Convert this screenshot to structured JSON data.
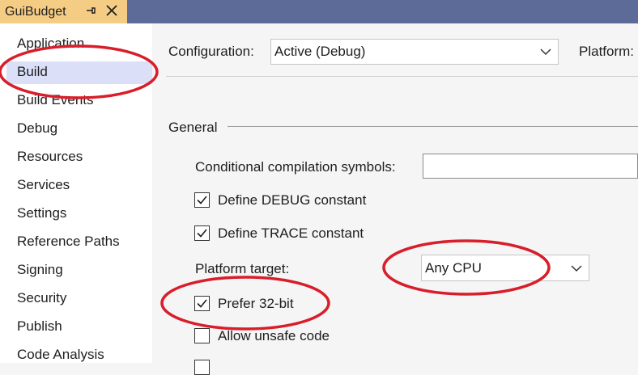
{
  "document_tab": {
    "title": "GuiBudget",
    "pin_icon": "pin-icon",
    "close_icon": "close-icon"
  },
  "sidebar": {
    "items": [
      {
        "label": "Application"
      },
      {
        "label": "Build",
        "selected": true
      },
      {
        "label": "Build Events"
      },
      {
        "label": "Debug"
      },
      {
        "label": "Resources"
      },
      {
        "label": "Services"
      },
      {
        "label": "Settings"
      },
      {
        "label": "Reference Paths"
      },
      {
        "label": "Signing"
      },
      {
        "label": "Security"
      },
      {
        "label": "Publish"
      },
      {
        "label": "Code Analysis"
      }
    ]
  },
  "header": {
    "configuration_label": "Configuration:",
    "configuration_value": "Active (Debug)",
    "platform_label": "Platform:"
  },
  "general": {
    "section_label": "General",
    "conditional_symbols_label": "Conditional compilation symbols:",
    "conditional_symbols_value": "",
    "define_debug": {
      "label": "Define DEBUG constant",
      "checked": true
    },
    "define_trace": {
      "label": "Define TRACE constant",
      "checked": true
    },
    "platform_target_label": "Platform target:",
    "platform_target_value": "Any CPU",
    "prefer_32bit": {
      "label": "Prefer 32-bit",
      "checked": true
    },
    "allow_unsafe": {
      "label": "Allow unsafe code",
      "checked": false
    }
  },
  "colors": {
    "titlebar": "#5d6b99",
    "active_tab": "#f5cc84",
    "selected_item": "#dbe0f8",
    "annotation_red": "#d81e2a"
  }
}
